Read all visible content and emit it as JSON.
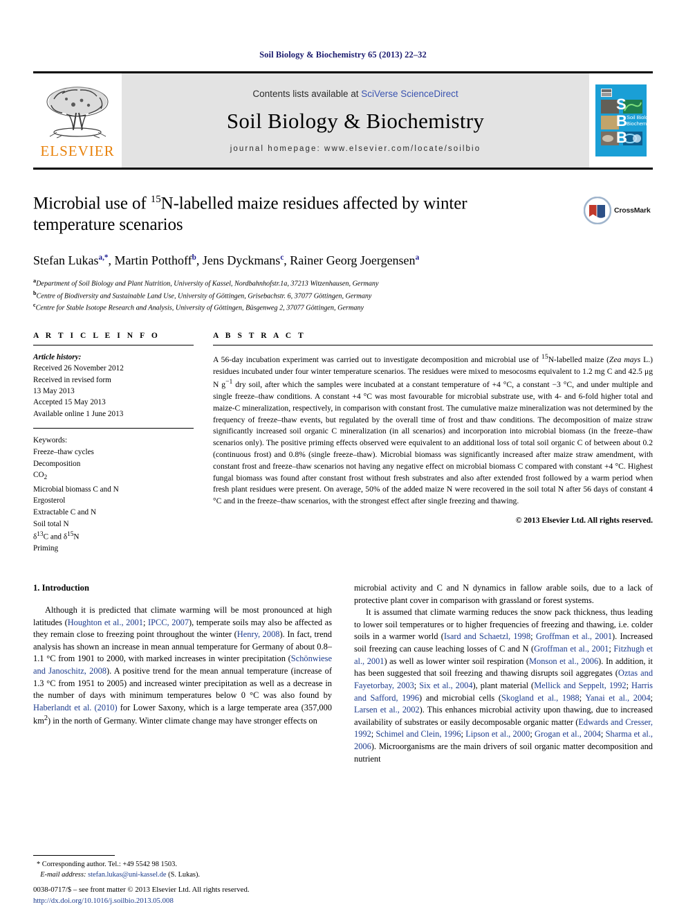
{
  "running_head": "Soil Biology & Biochemistry 65 (2013) 22–32",
  "masthead": {
    "publisher_name": "ELSEVIER",
    "contents_prefix": "Contents lists available at ",
    "contents_link": "SciVerse ScienceDirect",
    "journal_name": "Soil Biology & Biochemistry",
    "homepage": "journal homepage: www.elsevier.com/locate/soilbio",
    "cover_letters": [
      "S",
      "B",
      "B"
    ],
    "cover_title_line1": "Soil Biology &",
    "cover_title_line2": "Biochemistry",
    "link_color": "#3a53b0",
    "elsevier_orange": "#e8820c",
    "cover_blue": "#1a9fd6"
  },
  "article": {
    "title_part1": "Microbial use of ",
    "title_sup": "15",
    "title_part2": "N-labelled maize residues affected by winter temperature scenarios",
    "crossmark_label": "CrossMark",
    "authors": [
      {
        "name": "Stefan Lukas",
        "sup": "a,*"
      },
      {
        "name": "Martin Potthoff",
        "sup": "b"
      },
      {
        "name": "Jens Dyckmans",
        "sup": "c"
      },
      {
        "name": "Rainer Georg Joergensen",
        "sup": "a"
      }
    ],
    "affiliations": [
      {
        "marker": "a",
        "text": "Department of Soil Biology and Plant Nutrition, University of Kassel, Nordbahnhofstr.1a, 37213 Witzenhausen, Germany"
      },
      {
        "marker": "b",
        "text": "Centre of Biodiversity and Sustainable Land Use, University of Göttingen, Grisebachstr. 6, 37077 Göttingen, Germany"
      },
      {
        "marker": "c",
        "text": "Centre for Stable Isotope Research and Analysis, University of Göttingen, Büsgenweg 2, 37077 Göttingen, Germany"
      }
    ]
  },
  "article_info": {
    "heading": "A R T I C L E  I N F O",
    "history_label": "Article history:",
    "history": [
      "Received 26 November 2012",
      "Received in revised form",
      "13 May 2013",
      "Accepted 15 May 2013",
      "Available online 1 June 2013"
    ],
    "keywords_label": "Keywords:",
    "keywords": [
      "Freeze–thaw cycles",
      "Decomposition",
      "CO2",
      "Microbial biomass C and N",
      "Ergosterol",
      "Extractable C and N",
      "Soil total N",
      "δ13C and δ15N",
      "Priming"
    ]
  },
  "abstract": {
    "heading": "A B S T R A C T",
    "text_p1": "A 56-day incubation experiment was carried out to investigate decomposition and microbial use of ",
    "sup_15n": "15",
    "text_p2": "N-labelled maize (",
    "italic_species": "Zea mays",
    "text_p3": " L.) residues incubated under four winter temperature scenarios. The residues were mixed to mesocosms equivalent to 1.2 mg C and 42.5 μg N g",
    "sup_g": "−1",
    "text_p4": " dry soil, after which the samples were incubated at a constant temperature of +4 °C, a constant −3 °C, and under multiple and single freeze–thaw conditions. A constant +4 °C was most favourable for microbial substrate use, with 4- and 6-fold higher total and maize-C mineralization, respectively, in comparison with constant frost. The cumulative maize mineralization was not determined by the frequency of freeze–thaw events, but regulated by the overall time of frost and thaw conditions. The decomposition of maize straw significantly increased soil organic C mineralization (in all scenarios) and incorporation into microbial biomass (in the freeze–thaw scenarios only). The positive priming effects observed were equivalent to an additional loss of total soil organic C of between about 0.2 (continuous frost) and 0.8% (single freeze–thaw). Microbial biomass was significantly increased after maize straw amendment, with constant frost and freeze–thaw scenarios not having any negative effect on microbial biomass C compared with constant +4 °C. Highest fungal biomass was found after constant frost without fresh substrates and also after extended frost followed by a warm period when fresh plant residues were present. On average, 50% of the added maize N were recovered in the soil total N after 56 days of constant 4 °C and in the freeze–thaw scenarios, with the strongest effect after single freezing and thawing.",
    "copyright": "© 2013 Elsevier Ltd. All rights reserved."
  },
  "introduction": {
    "heading": "1. Introduction",
    "left_p1_a": "Although it is predicted that climate warming will be most pronounced at high latitudes (",
    "left_cite1": "Houghton et al., 2001",
    "left_p1_b": "; ",
    "left_cite2": "IPCC, 2007",
    "left_p1_c": "), temperate soils may also be affected as they remain close to freezing point throughout the winter (",
    "left_cite3": "Henry, 2008",
    "left_p1_d": "). In fact, trend analysis has shown an increase in mean annual temperature for Germany of about 0.8–1.1 °C from 1901 to 2000, with marked increases in winter precipitation (",
    "left_cite4": "Schönwiese and Janoschitz, 2008",
    "left_p1_e": "). A positive trend for the mean annual temperature (increase of 1.3 °C from 1951 to 2005) and increased winter precipitation as well as a decrease in the number of days with minimum temperatures below 0 °C was also found by ",
    "left_cite5": "Haberlandt et al. (2010)",
    "left_p1_f": " for Lower Saxony, which is a large temperate area (357,000 km",
    "left_sup": "2",
    "left_p1_g": ") in the north of Germany. Winter climate change may have stronger effects on",
    "right_p1": "microbial activity and C and N dynamics in fallow arable soils, due to a lack of protective plant cover in comparison with grassland or forest systems.",
    "right_p2_a": "It is assumed that climate warming reduces the snow pack thickness, thus leading to lower soil temperatures or to higher frequencies of freezing and thawing, i.e. colder soils in a warmer world (",
    "right_cite1": "Isard and Schaetzl, 1998",
    "right_p2_b": "; ",
    "right_cite2": "Groffman et al., 2001",
    "right_p2_c": "). Increased soil freezing can cause leaching losses of C and N (",
    "right_cite3": "Groffman et al., 2001",
    "right_p2_d": "; ",
    "right_cite4": "Fitzhugh et al., 2001",
    "right_p2_e": ") as well as lower winter soil respiration (",
    "right_cite5": "Monson et al., 2006",
    "right_p2_f": "). In addition, it has been suggested that soil freezing and thawing disrupts soil aggregates (",
    "right_cite6": "Oztas and Fayetorbay, 2003",
    "right_p2_g": "; ",
    "right_cite7": "Six et al., 2004",
    "right_p2_h": "), plant material (",
    "right_cite8": "Mellick and Seppelt, 1992",
    "right_p2_i": "; ",
    "right_cite9": "Harris and Safford, 1996",
    "right_p2_j": ") and microbial cells (",
    "right_cite10": "Skogland et al., 1988",
    "right_p2_k": "; ",
    "right_cite11": "Yanai et al., 2004",
    "right_p2_l": "; ",
    "right_cite12": "Larsen et al., 2002",
    "right_p2_m": "). This enhances microbial activity upon thawing, due to increased availability of substrates or easily decomposable organic matter (",
    "right_cite13": "Edwards and Cresser, 1992",
    "right_p2_n": "; ",
    "right_cite14": "Schimel and Clein, 1996",
    "right_p2_o": "; ",
    "right_cite15": "Lipson et al., 2000",
    "right_p2_p": "; ",
    "right_cite16": "Grogan et al., 2004",
    "right_p2_q": "; ",
    "right_cite17": "Sharma et al., 2006",
    "right_p2_r": "). Microorganisms are the main drivers of soil organic matter decomposition and nutrient"
  },
  "footnotes": {
    "corresponding": "* Corresponding author. Tel.: +49 5542 98 1503.",
    "email_label": "E-mail address:",
    "email": "stefan.lukas@uni-kassel.de",
    "email_suffix": " (S. Lukas)."
  },
  "footer": {
    "issn_line": "0038-0717/$ – see front matter © 2013 Elsevier Ltd. All rights reserved.",
    "doi": "http://dx.doi.org/10.1016/j.soilbio.2013.05.008"
  }
}
